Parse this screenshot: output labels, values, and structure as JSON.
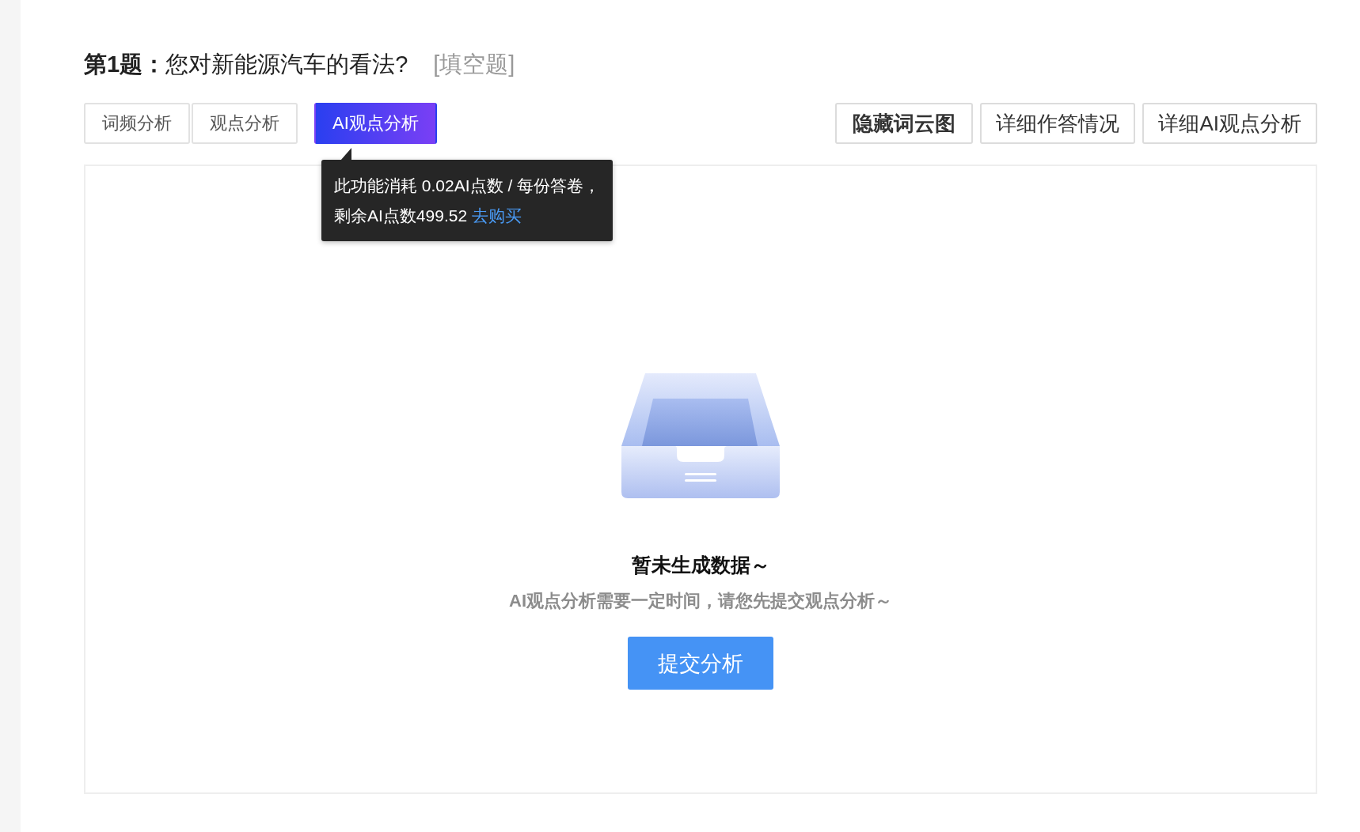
{
  "question": {
    "number_label": "第1题：",
    "text": "您对新能源汽车的看法?",
    "type_tag": "[填空题]"
  },
  "tabs": [
    {
      "label": "词频分析",
      "selected": false
    },
    {
      "label": "观点分析",
      "selected": false
    },
    {
      "label": "AI观点分析",
      "selected": true
    }
  ],
  "actions": [
    {
      "label": "隐藏词云图",
      "bold": true
    },
    {
      "label": "详细作答情况",
      "bold": false
    },
    {
      "label": "详细AI观点分析",
      "bold": false
    }
  ],
  "tooltip": {
    "lines": [
      "此功能消耗 0.02AI点数 / 每份答卷，",
      "剩余AI点数499.52"
    ],
    "link": "去购买"
  },
  "empty_state": {
    "title": "暂未生成数据～",
    "description": "AI观点分析需要一定时间，请您先提交观点分析～",
    "button": "提交分析"
  }
}
